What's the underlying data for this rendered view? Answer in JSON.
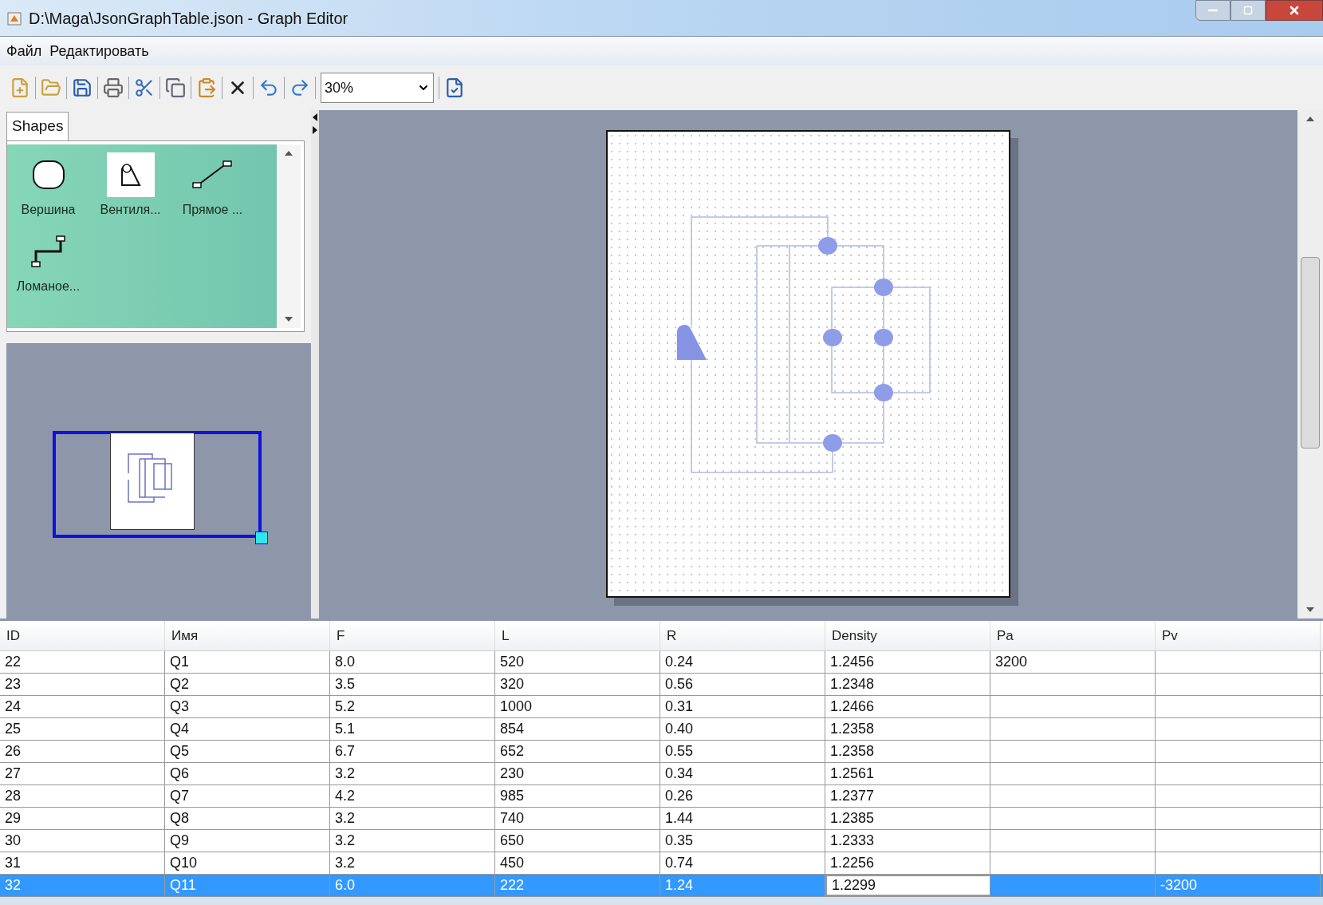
{
  "window": {
    "title": "D:\\Maga\\JsonGraphTable.json - Graph Editor"
  },
  "menu": [
    "Файл",
    "Редактировать"
  ],
  "toolbar": {
    "zoom": "30%"
  },
  "palette": {
    "tab": "Shapes",
    "items": [
      {
        "label": "Вершина",
        "kind": "ellipse",
        "selected": false
      },
      {
        "label": "Вентиля...",
        "kind": "valve",
        "selected": true
      },
      {
        "label": "Прямое ...",
        "kind": "line",
        "selected": false
      },
      {
        "label": "Ломаное...",
        "kind": "polyline",
        "selected": false
      }
    ]
  },
  "table": {
    "columns": [
      "ID",
      "Имя",
      "F",
      "L",
      "R",
      "Density",
      "Pa",
      "Pv"
    ],
    "rows": [
      {
        "selected": false,
        "cells": [
          {
            "text": "22",
            "editing": false
          },
          {
            "text": "Q1",
            "editing": false
          },
          {
            "text": "8.0",
            "editing": false
          },
          {
            "text": "520",
            "editing": false
          },
          {
            "text": "0.24",
            "editing": false
          },
          {
            "text": "1.2456",
            "editing": false
          },
          {
            "text": "3200",
            "editing": false
          },
          null
        ]
      },
      {
        "selected": false,
        "cells": [
          {
            "text": "23",
            "editing": false
          },
          {
            "text": "Q2",
            "editing": false
          },
          {
            "text": "3.5",
            "editing": false
          },
          {
            "text": "320",
            "editing": false
          },
          {
            "text": "0.56",
            "editing": false
          },
          {
            "text": "1.2348",
            "editing": false
          },
          null,
          null
        ]
      },
      {
        "selected": false,
        "cells": [
          {
            "text": "24",
            "editing": false
          },
          {
            "text": "Q3",
            "editing": false
          },
          {
            "text": "5.2",
            "editing": false
          },
          {
            "text": "1000",
            "editing": false
          },
          {
            "text": "0.31",
            "editing": false
          },
          {
            "text": "1.2466",
            "editing": false
          },
          null,
          null
        ]
      },
      {
        "selected": false,
        "cells": [
          {
            "text": "25",
            "editing": false
          },
          {
            "text": "Q4",
            "editing": false
          },
          {
            "text": "5.1",
            "editing": false
          },
          {
            "text": "854",
            "editing": false
          },
          {
            "text": "0.40",
            "editing": false
          },
          {
            "text": "1.2358",
            "editing": false
          },
          null,
          null
        ]
      },
      {
        "selected": false,
        "cells": [
          {
            "text": "26",
            "editing": false
          },
          {
            "text": "Q5",
            "editing": false
          },
          {
            "text": "6.7",
            "editing": false
          },
          {
            "text": "652",
            "editing": false
          },
          {
            "text": "0.55",
            "editing": false
          },
          {
            "text": "1.2358",
            "editing": false
          },
          null,
          null
        ]
      },
      {
        "selected": false,
        "cells": [
          {
            "text": "27",
            "editing": false
          },
          {
            "text": "Q6",
            "editing": false
          },
          {
            "text": "3.2",
            "editing": false
          },
          {
            "text": "230",
            "editing": false
          },
          {
            "text": "0.34",
            "editing": false
          },
          {
            "text": "1.2561",
            "editing": false
          },
          null,
          null
        ]
      },
      {
        "selected": false,
        "cells": [
          {
            "text": "28",
            "editing": false
          },
          {
            "text": "Q7",
            "editing": false
          },
          {
            "text": "4.2",
            "editing": false
          },
          {
            "text": "985",
            "editing": false
          },
          {
            "text": "0.26",
            "editing": false
          },
          {
            "text": "1.2377",
            "editing": false
          },
          null,
          null
        ]
      },
      {
        "selected": false,
        "cells": [
          {
            "text": "29",
            "editing": false
          },
          {
            "text": "Q8",
            "editing": false
          },
          {
            "text": "3.2",
            "editing": false
          },
          {
            "text": "740",
            "editing": false
          },
          {
            "text": "1.44",
            "editing": false
          },
          {
            "text": "1.2385",
            "editing": false
          },
          null,
          null
        ]
      },
      {
        "selected": false,
        "cells": [
          {
            "text": "30",
            "editing": false
          },
          {
            "text": "Q9",
            "editing": false
          },
          {
            "text": "3.2",
            "editing": false
          },
          {
            "text": "650",
            "editing": false
          },
          {
            "text": "0.35",
            "editing": false
          },
          {
            "text": "1.2333",
            "editing": false
          },
          null,
          null
        ]
      },
      {
        "selected": false,
        "cells": [
          {
            "text": "31",
            "editing": false
          },
          {
            "text": "Q10",
            "editing": false
          },
          {
            "text": "3.2",
            "editing": false
          },
          {
            "text": "450",
            "editing": false
          },
          {
            "text": "0.74",
            "editing": false
          },
          {
            "text": "1.2256",
            "editing": false
          },
          null,
          null
        ]
      },
      {
        "selected": true,
        "cells": [
          {
            "text": "32",
            "editing": false
          },
          {
            "text": "Q11",
            "editing": false
          },
          {
            "text": "6.0",
            "editing": false
          },
          {
            "text": "222",
            "editing": false
          },
          {
            "text": "1.24",
            "editing": false
          },
          {
            "text": "1.2299",
            "editing": true
          },
          null,
          {
            "text": "-3200",
            "editing": false
          }
        ]
      }
    ]
  }
}
